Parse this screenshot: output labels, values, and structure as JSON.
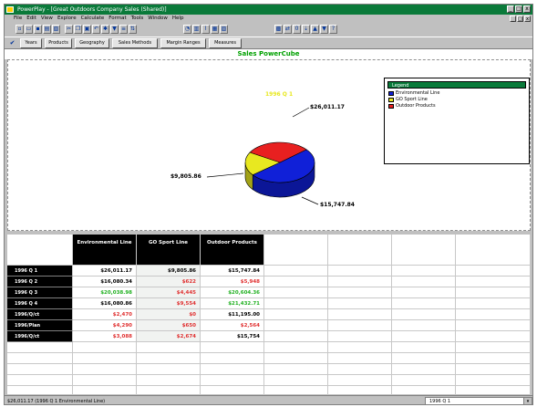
{
  "window": {
    "title": "PowerPlay - [Great Outdoors Company Sales (Shared)]",
    "min_label": "_",
    "max_label": "□",
    "close_label": "x"
  },
  "menu": [
    "File",
    "Edit",
    "View",
    "Explore",
    "Calculate",
    "Format",
    "Tools",
    "Window",
    "Help"
  ],
  "toolbar_icons": [
    "new-icon",
    "open-icon",
    "save-icon",
    "print-icon",
    "preview-icon",
    "cut-icon",
    "copy-icon",
    "paste-icon",
    "undo-icon",
    "explain-icon",
    "filter-icon",
    "rank-icon",
    "sort-icon",
    "pie-chart-icon",
    "bar-chart-icon",
    "line-chart-icon",
    "crosstab-icon",
    "indicator-icon",
    "explorer-icon",
    "swap-icon",
    "zero-icon",
    "drill-icon",
    "up-icon",
    "down-icon",
    "help-icon"
  ],
  "dimension_line": [
    "Years",
    "Products",
    "Geography",
    "Sales Methods",
    "Margin Ranges",
    "Measures"
  ],
  "chart_data": {
    "type": "pie",
    "title": "Sales PowerCube",
    "legend_title": "Legend",
    "legend_position": "top-right",
    "series_label": "1996 Q 1",
    "slices": [
      {
        "name": "Environmental Line",
        "value": 26011.17,
        "label": "$26,011.17",
        "color": "#1020d8"
      },
      {
        "name": "GO Sport Line",
        "value": 9805.86,
        "label": "$9,805.86",
        "color": "#e8e820"
      },
      {
        "name": "Outdoor Products",
        "value": 15747.84,
        "label": "$15,747.84",
        "color": "#e82020"
      }
    ]
  },
  "grid": {
    "columns": [
      {
        "label": "Environmental Line"
      },
      {
        "label": "GO Sport Line"
      },
      {
        "label": "Outdoor Products"
      }
    ],
    "rows": [
      {
        "label": "1996 Q 1",
        "values": [
          "$26,011.17",
          "$9,805.86",
          "$15,747.84"
        ],
        "colors": [
          "#000000",
          "#000000",
          "#000000"
        ]
      },
      {
        "label": "1996 Q 2",
        "values": [
          "$16,080.34",
          "$622",
          "$5,948"
        ],
        "colors": [
          "#000000",
          "#e03030",
          "#e03030"
        ]
      },
      {
        "label": "1996 Q 3",
        "values": [
          "$20,038.98",
          "$4,445",
          "$20,604.36"
        ],
        "colors": [
          "#20b020",
          "#e03030",
          "#20b020"
        ]
      },
      {
        "label": "1996 Q 4",
        "values": [
          "$16,080.86",
          "$9,554",
          "$21,432.71"
        ],
        "colors": [
          "#000000",
          "#e03030",
          "#20b020"
        ]
      },
      {
        "label": "1996/Q/ct",
        "values": [
          "$2,470",
          "$0",
          "$11,195.00"
        ],
        "colors": [
          "#e03030",
          "#e03030",
          "#000000"
        ]
      },
      {
        "label": "1996/Plan",
        "values": [
          "$4,290",
          "$650",
          "$2,564"
        ],
        "colors": [
          "#e03030",
          "#e03030",
          "#e03030"
        ]
      },
      {
        "label": "1996/Q/ct",
        "values": [
          "$3,088",
          "$2,674",
          "$15,754"
        ],
        "colors": [
          "#e03030",
          "#e03030",
          "#000000"
        ]
      }
    ]
  },
  "status": {
    "text": "$26,011.17 (1996 Q 1 Environmental Line)",
    "combo_value": "1996 Q 1",
    "combo_arrow": "▾"
  }
}
